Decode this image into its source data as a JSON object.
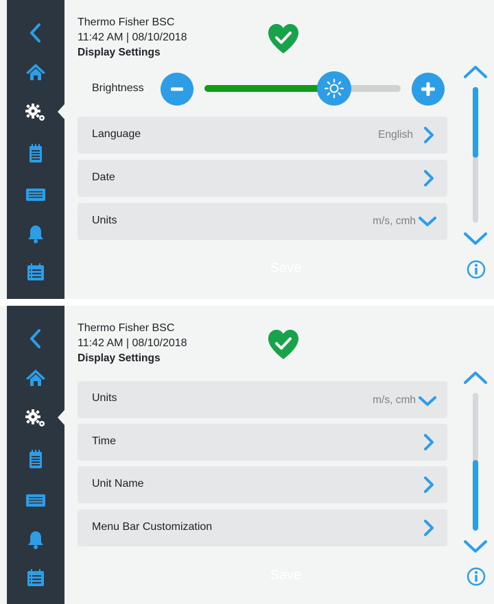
{
  "colors": {
    "accent": "#2d9de6",
    "sidebar": "#2b3640",
    "brightness_fill": "#109c15",
    "status_ok": "#18a24a"
  },
  "sidebar": {
    "items": [
      {
        "icon": "back-arrow-icon"
      },
      {
        "icon": "home-icon"
      },
      {
        "icon": "gears-icon",
        "active": true
      },
      {
        "icon": "notepad-icon"
      },
      {
        "icon": "filter-panel-icon"
      },
      {
        "icon": "bell-icon"
      },
      {
        "icon": "calendar-list-icon"
      }
    ]
  },
  "screen1": {
    "header": {
      "device": "Thermo Fisher BSC",
      "datetime": "11:42  AM | 08/10/2018",
      "title": "Display Settings"
    },
    "status_icon": "heart-check-icon",
    "brightness": {
      "label": "Brightness",
      "level": 0.66
    },
    "rows": [
      {
        "label": "Language",
        "value": "English",
        "icon": "chevron-right-icon"
      },
      {
        "label": "Date",
        "value": "",
        "icon": "chevron-right-icon"
      },
      {
        "label": "Units",
        "value": "m/s, cmh",
        "icon": "chevron-down-icon"
      }
    ],
    "save_label": "Save",
    "scroll_position": 0.0
  },
  "screen2": {
    "header": {
      "device": "Thermo Fisher BSC",
      "datetime": "11:42  AM | 08/10/2018",
      "title": "Display Settings"
    },
    "status_icon": "heart-check-icon",
    "rows": [
      {
        "label": "Units",
        "value": "m/s, cmh",
        "icon": "chevron-down-icon"
      },
      {
        "label": "Time",
        "value": "",
        "icon": "chevron-right-icon"
      },
      {
        "label": "Unit Name",
        "value": "",
        "icon": "chevron-right-icon"
      },
      {
        "label": "Menu Bar Customization",
        "value": "",
        "icon": "chevron-right-icon"
      }
    ],
    "save_label": "Save",
    "scroll_position": 1.0
  }
}
